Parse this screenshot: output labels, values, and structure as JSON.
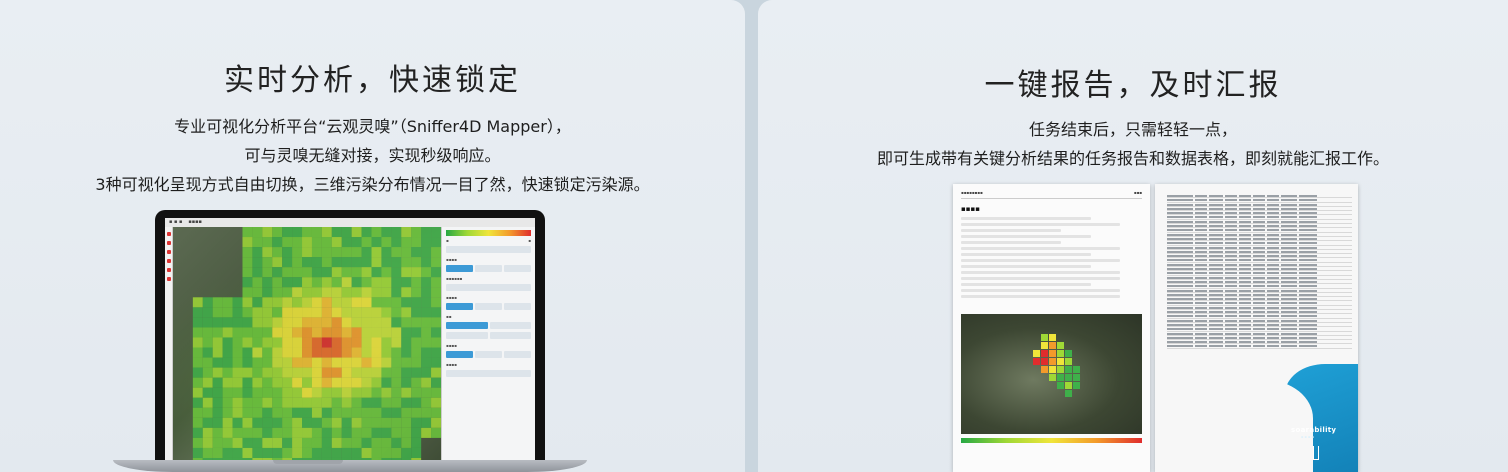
{
  "left_panel": {
    "title": "实时分析，快速锁定",
    "desc_lines": [
      "专业可视化分析平台“云观灵嗅”（Sniffer4D Mapper），",
      "可与灵嗅无缝对接，实现秒级响应。",
      "3种可视化呈现方式自由切换，三维污染分布情况一目了然，快速锁定污染源。"
    ]
  },
  "right_panel": {
    "title": "一键报告，及时汇报",
    "desc_lines": [
      "任务结束后，只需轻轻一点，",
      "即可生成带有关键分析结果的任务报告和数据表格，即刻就能汇报工作。"
    ]
  },
  "report": {
    "brand": "soarability"
  },
  "colors": {
    "heat_low": "#27a844",
    "heat_mid": "#f0e53a",
    "heat_high": "#e02d2d",
    "brand_blue": "#1a94cc"
  }
}
